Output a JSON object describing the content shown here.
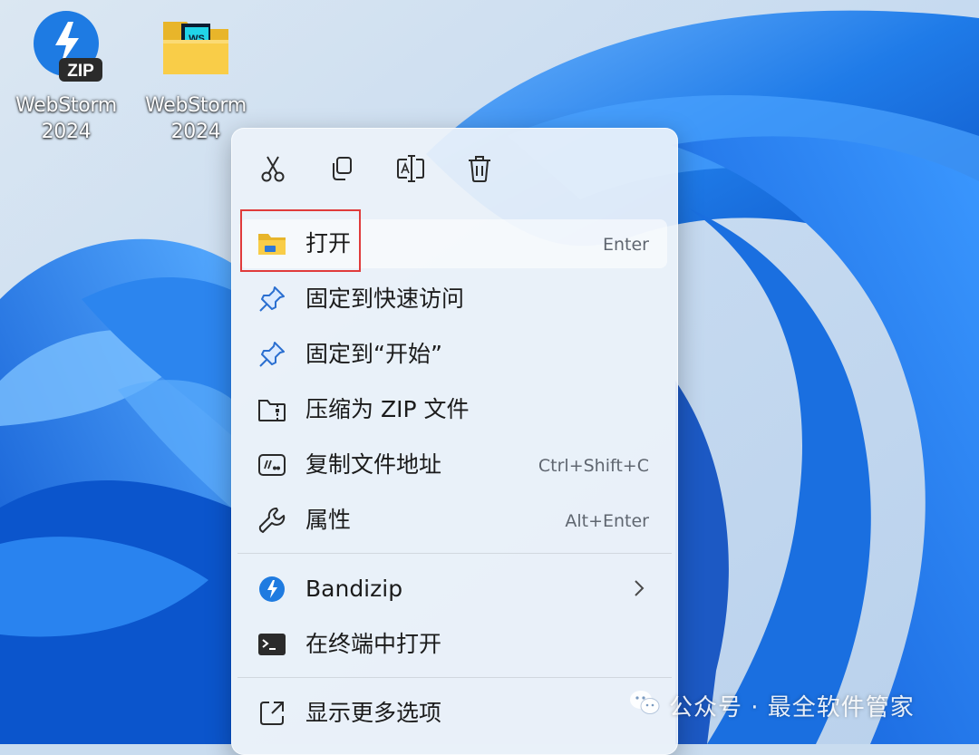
{
  "desktop": {
    "icons": [
      {
        "label_line1": "WebStorm",
        "label_line2": "2024",
        "icon": "bandizip-zip-icon",
        "badge": "ZIP"
      },
      {
        "label_line1": "WebStorm",
        "label_line2": "2024",
        "icon": "folder-icon",
        "badge": "WS"
      }
    ]
  },
  "context_menu": {
    "toolbar": [
      {
        "name": "cut",
        "icon": "scissors-icon"
      },
      {
        "name": "copy",
        "icon": "copy-icon"
      },
      {
        "name": "rename",
        "icon": "rename-icon"
      },
      {
        "name": "delete",
        "icon": "trash-icon"
      }
    ],
    "items": [
      {
        "label": "打开",
        "shortcut": "Enter",
        "icon": "folder-icon"
      },
      {
        "label": "固定到快速访问",
        "shortcut": "",
        "icon": "pin-icon"
      },
      {
        "label": "固定到“开始”",
        "shortcut": "",
        "icon": "pin-icon"
      },
      {
        "label": "压缩为 ZIP 文件",
        "shortcut": "",
        "icon": "zip-folder-icon"
      },
      {
        "label": "复制文件地址",
        "shortcut": "Ctrl+Shift+C",
        "icon": "path-icon"
      },
      {
        "label": "属性",
        "shortcut": "Alt+Enter",
        "icon": "wrench-icon"
      }
    ],
    "extra_items": [
      {
        "label": "Bandizip",
        "icon": "bandizip-icon",
        "has_submenu": true
      },
      {
        "label": "在终端中打开",
        "icon": "terminal-icon"
      }
    ],
    "more": {
      "label": "显示更多选项",
      "icon": "more-options-icon"
    }
  },
  "watermark": {
    "text": "公众号 · 最全软件管家",
    "icon": "wechat-icon"
  },
  "colors": {
    "accent": "#1f7be0",
    "highlight_box": "#e03b3b",
    "folder_yellow": "#f7c83c"
  }
}
